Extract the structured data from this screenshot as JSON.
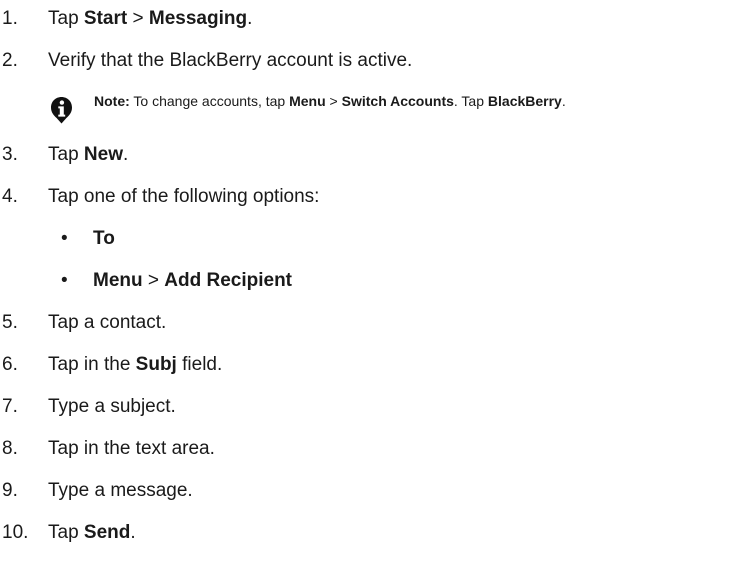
{
  "steps": [
    {
      "n": "1.",
      "pre": "Tap ",
      "b1": "Start",
      "mid": " > ",
      "b2": "Messaging",
      "post": "."
    },
    {
      "n": "2.",
      "text": "Verify that the BlackBerry account is active."
    },
    {
      "n": "3.",
      "pre": "Tap ",
      "b1": "New",
      "post": "."
    },
    {
      "n": "4.",
      "text": "Tap one of the following options:"
    },
    {
      "n": "5.",
      "text": "Tap a contact."
    },
    {
      "n": "6.",
      "pre": "Tap in the ",
      "b1": "Subj",
      "post": " field."
    },
    {
      "n": "7.",
      "text": "Type a subject."
    },
    {
      "n": "8.",
      "text": "Tap in the text area."
    },
    {
      "n": "9.",
      "text": "Type a message."
    },
    {
      "n": "10.",
      "pre": "Tap ",
      "b1": "Send",
      "post": "."
    }
  ],
  "note": {
    "icon": "info-icon",
    "label": "Note:",
    "pre": " To change accounts, tap ",
    "b1": "Menu",
    "mid": " > ",
    "b2": "Switch Accounts",
    "mid2": ". Tap ",
    "b3": "BlackBerry",
    "post": "."
  },
  "options": [
    {
      "bullet": "•",
      "b1": "To"
    },
    {
      "bullet": "•",
      "b1": "Menu",
      "mid": " > ",
      "b2": "Add Recipient"
    }
  ]
}
